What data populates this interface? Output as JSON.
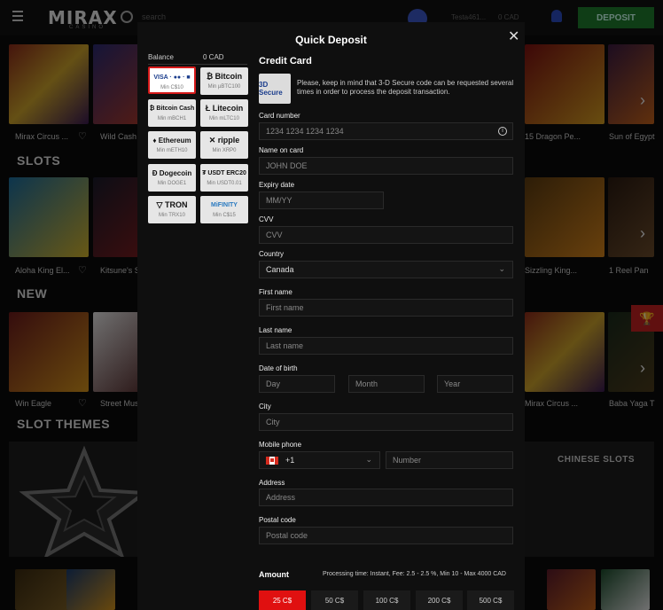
{
  "header": {
    "logo": "MIRAX",
    "logo_sub": "CASINO",
    "search_placeholder": "search",
    "username": "Testa461...",
    "balance": "0 CAD",
    "deposit_label": "DEPOSIT"
  },
  "background": {
    "row1": [
      "Mirax Circus ...",
      "Wild Cash",
      "15 Dragon Pe...",
      "Sun of Egypt"
    ],
    "sections": [
      "SLOTS",
      "NEW",
      "SLOT THEMES"
    ],
    "row2": [
      "Aloha King El...",
      "Kitsune's S",
      "Sizzling King...",
      "1 Reel Pan"
    ],
    "row3": [
      "Win Eagle",
      "Street Mus",
      "Mirax Circus ...",
      "Baba Yaga T"
    ],
    "theme_right": "CHINESE SLOTS"
  },
  "modal": {
    "title": "Quick Deposit",
    "balance_label": "Balance",
    "balance_value": "0 CAD",
    "methods": [
      {
        "name": "VISA · ●● · ■",
        "min": "Min C$10",
        "selected": true
      },
      {
        "name": "₿ Bitcoin",
        "min": "Min µBTC100",
        "selected": false
      },
      {
        "name": "₿ Bitcoin Cash",
        "min": "Min mBCH1",
        "selected": false
      },
      {
        "name": "Ł Litecoin",
        "min": "Min mLTC10",
        "selected": false
      },
      {
        "name": "♦ Ethereum",
        "min": "Min mETH10",
        "selected": false
      },
      {
        "name": "✕ ripple",
        "min": "Min XRP0",
        "selected": false
      },
      {
        "name": "Ð Dogecoin",
        "min": "Min DOGE1",
        "selected": false
      },
      {
        "name": "₮ USDT ERC20",
        "min": "Min USDT0.01",
        "selected": false
      },
      {
        "name": "▽ TRON",
        "min": "Min TRX10",
        "selected": false
      },
      {
        "name": "MiFINITY",
        "min": "Min C$15",
        "selected": false
      }
    ],
    "form_title": "Credit Card",
    "secure_badge": "3D Secure",
    "secure_note": "Please, keep in mind that 3-D Secure code can be requested several times in order to process the deposit transaction.",
    "fields": {
      "card_number": {
        "label": "Card number",
        "placeholder": "1234 1234 1234 1234"
      },
      "name_on_card": {
        "label": "Name on card",
        "placeholder": "JOHN DOE"
      },
      "expiry": {
        "label": "Expiry date",
        "placeholder": "MM/YY"
      },
      "cvv": {
        "label": "CVV",
        "placeholder": "CVV"
      },
      "country": {
        "label": "Country",
        "value": "Canada"
      },
      "first_name": {
        "label": "First name",
        "placeholder": "First name"
      },
      "last_name": {
        "label": "Last name",
        "placeholder": "Last name"
      },
      "dob": {
        "label": "Date of birth",
        "day": "Day",
        "month": "Month",
        "year": "Year"
      },
      "city": {
        "label": "City",
        "placeholder": "City"
      },
      "phone": {
        "label": "Mobile phone",
        "code": "+1",
        "placeholder": "Number"
      },
      "address": {
        "label": "Address",
        "placeholder": "Address"
      },
      "postal": {
        "label": "Postal code",
        "placeholder": "Postal code"
      }
    },
    "amount_label": "Amount",
    "amount_note": "Processing time: Instant, Fee: 2.5 - 2.5 %, Min 10 - Max 4000 CAD",
    "amounts": [
      "25 C$",
      "50 C$",
      "100 C$",
      "200 C$",
      "500 C$"
    ],
    "selected_amount": "25 C$"
  },
  "colors": {
    "accent": "#e01010",
    "deposit_green": "#1e7a2c",
    "selected_border": "#d51a1a"
  }
}
